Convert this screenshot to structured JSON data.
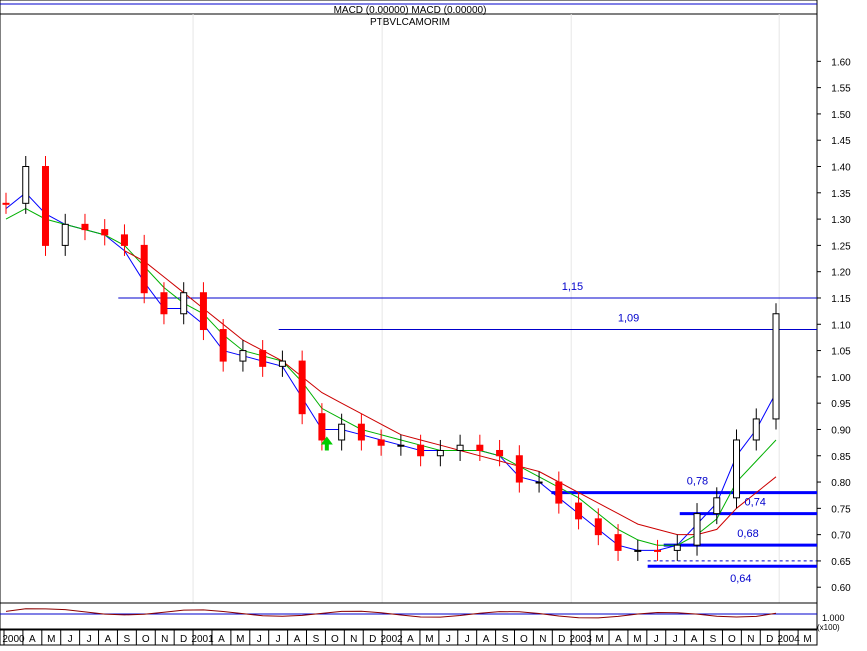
{
  "chart_data": {
    "type": "candlestick",
    "header": {
      "macd_text": "MACD (0.00000) MACD (0.00000)",
      "symbol": "PTBVLCAMORIM"
    },
    "y_axis": {
      "min": 0.57,
      "max": 1.69,
      "ticks": [
        "1.60",
        "1.55",
        "1.50",
        "1.45",
        "1.40",
        "1.35",
        "1.30",
        "1.25",
        "1.20",
        "1.15",
        "1.10",
        "1.05",
        "1.00",
        "0.95",
        "0.90",
        "0.85",
        "0.80",
        "0.75",
        "0.70",
        "0.65",
        "0.60"
      ],
      "footer_label": "1.000",
      "unit_label": "(x100)"
    },
    "x_axis": {
      "labels": [
        "2000",
        "A",
        "M",
        "J",
        "J",
        "A",
        "S",
        "O",
        "N",
        "D",
        "2001",
        "A",
        "M",
        "J",
        "J",
        "A",
        "S",
        "O",
        "N",
        "D",
        "2002",
        "A",
        "M",
        "J",
        "J",
        "A",
        "S",
        "O",
        "N",
        "D",
        "2003",
        "M",
        "A",
        "M",
        "J",
        "J",
        "A",
        "S",
        "O",
        "N",
        "D",
        "2004",
        "M"
      ]
    },
    "horizontal_levels": [
      {
        "label": "1,15",
        "value": 1.15,
        "color": "#0000cc",
        "weight": "thin",
        "start": "2000-08"
      },
      {
        "label": "1,09",
        "value": 1.09,
        "color": "#0000cc",
        "weight": "thin",
        "start": "2001-06"
      },
      {
        "label": "0,78",
        "value": 0.78,
        "color": "#0000ff",
        "weight": "thick",
        "start": "2002-11"
      },
      {
        "label": "0,74",
        "value": 0.74,
        "color": "#0000ff",
        "weight": "thick",
        "start": "2003-07"
      },
      {
        "label": "0,68",
        "value": 0.68,
        "color": "#0000ff",
        "weight": "thick",
        "start": "2003-06"
      },
      {
        "label": "0,64",
        "value": 0.64,
        "color": "#0000ff",
        "weight": "thick",
        "start": "2003-05"
      }
    ],
    "dashed_level": {
      "value": 0.65
    },
    "series_price": {
      "dates": [
        "2000-01",
        "2000-02",
        "2000-03",
        "2000-04",
        "2000-05",
        "2000-06",
        "2000-07",
        "2000-08",
        "2000-09",
        "2000-10",
        "2000-11",
        "2000-12",
        "2001-01",
        "2001-02",
        "2001-03",
        "2001-04",
        "2001-05",
        "2001-06",
        "2001-07",
        "2001-08",
        "2001-09",
        "2001-10",
        "2001-11",
        "2001-12",
        "2002-01",
        "2002-02",
        "2002-03",
        "2002-04",
        "2002-05",
        "2002-06",
        "2002-07",
        "2002-08",
        "2002-09",
        "2002-10",
        "2002-11",
        "2002-12",
        "2003-01",
        "2003-02",
        "2003-03",
        "2003-04",
        "2003-05",
        "2003-06",
        "2003-07",
        "2003-08",
        "2003-09",
        "2003-10",
        "2003-11",
        "2003-12",
        "2004-01"
      ],
      "close": [
        1.33,
        1.4,
        1.25,
        1.29,
        1.28,
        1.27,
        1.25,
        1.16,
        1.12,
        1.16,
        1.09,
        1.03,
        1.05,
        1.02,
        1.03,
        0.93,
        0.88,
        0.91,
        0.88,
        0.87,
        0.87,
        0.85,
        0.86,
        0.87,
        0.86,
        0.85,
        0.8,
        0.8,
        0.76,
        0.73,
        0.7,
        0.67,
        0.67,
        0.67,
        0.68,
        0.74,
        0.77,
        0.88,
        0.92,
        1.12
      ],
      "up": [
        false,
        true,
        false,
        true,
        false,
        false,
        false,
        false,
        false,
        true,
        false,
        false,
        true,
        false,
        true,
        false,
        false,
        true,
        false,
        false,
        true,
        false,
        true,
        true,
        false,
        false,
        false,
        true,
        false,
        false,
        false,
        false,
        true,
        false,
        true,
        true,
        true,
        true,
        true,
        true
      ]
    },
    "moving_averages": [
      {
        "color": "#0000ff",
        "values": [
          1.32,
          1.35,
          1.31,
          1.29,
          1.28,
          1.27,
          1.24,
          1.18,
          1.13,
          1.13,
          1.1,
          1.05,
          1.04,
          1.03,
          1.02,
          0.96,
          0.9,
          0.9,
          0.89,
          0.88,
          0.87,
          0.86,
          0.86,
          0.86,
          0.86,
          0.85,
          0.81,
          0.8,
          0.77,
          0.74,
          0.71,
          0.68,
          0.67,
          0.67,
          0.68,
          0.72,
          0.76,
          0.85,
          0.9,
          0.97
        ]
      },
      {
        "color": "#00b000",
        "values": [
          1.3,
          1.32,
          1.3,
          1.29,
          1.28,
          1.27,
          1.25,
          1.21,
          1.17,
          1.14,
          1.12,
          1.08,
          1.05,
          1.04,
          1.03,
          0.99,
          0.94,
          0.92,
          0.9,
          0.89,
          0.88,
          0.87,
          0.86,
          0.86,
          0.86,
          0.85,
          0.83,
          0.81,
          0.79,
          0.77,
          0.74,
          0.71,
          0.69,
          0.68,
          0.68,
          0.7,
          0.73,
          0.8,
          0.84,
          0.88
        ]
      },
      {
        "color": "#cc0000",
        "values": [
          null,
          null,
          null,
          null,
          null,
          null,
          1.24,
          1.22,
          1.19,
          1.16,
          1.13,
          1.1,
          1.07,
          1.05,
          1.03,
          1.0,
          0.97,
          0.95,
          0.93,
          0.91,
          0.89,
          0.88,
          0.87,
          0.86,
          0.85,
          0.84,
          0.83,
          0.82,
          0.8,
          0.78,
          0.76,
          0.74,
          0.72,
          0.71,
          0.7,
          0.7,
          0.71,
          0.75,
          0.78,
          0.81
        ]
      }
    ],
    "grid": true,
    "up_color": "#000000",
    "down_color": "#ff0000",
    "marker": {
      "type": "arrow-up",
      "color": "#00cc00",
      "date": "2001-09",
      "value": 0.86
    }
  }
}
